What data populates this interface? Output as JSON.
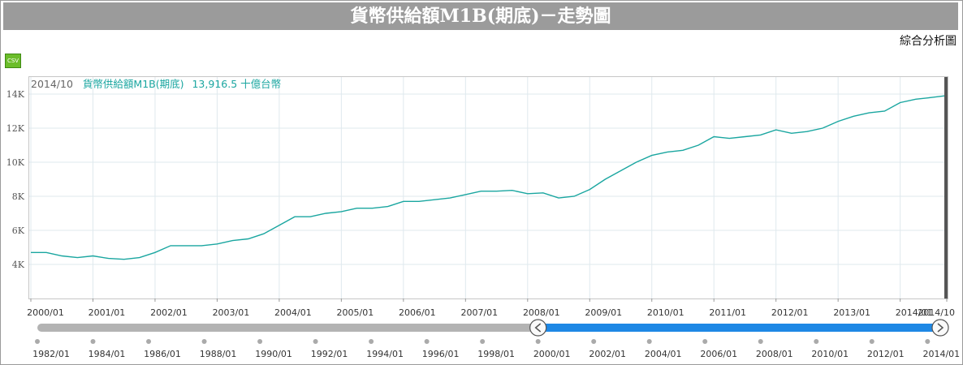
{
  "title": "貨幣供給額M1B(期底)－走勢圖",
  "nav_link": "綜合分析圖",
  "csv_label": "CSV",
  "colors": {
    "line": "#1aa6a0",
    "navigator_fill": "#1e88e5",
    "navigator_track": "#b3b3b3",
    "grid": "#dfe9ee",
    "title_bg": "#9b9b9b"
  },
  "readout": {
    "date": "2014/10",
    "series_name": "貨幣供給額M1B(期底)",
    "value": "13,916.5",
    "unit": "十億台幣"
  },
  "chart_data": {
    "type": "line",
    "title": "貨幣供給額M1B(期底)－走勢圖",
    "xlabel": "",
    "ylabel": "",
    "x_range": [
      "2000/01",
      "2014/10"
    ],
    "ylim": [
      2000,
      15000
    ],
    "y_ticks": [
      4000,
      6000,
      8000,
      10000,
      12000,
      14000
    ],
    "y_tick_labels": [
      "4K",
      "6K",
      "8K",
      "10K",
      "12K",
      "14K"
    ],
    "x_tick_labels": [
      "2000/01",
      "2001/01",
      "2002/01",
      "2003/01",
      "2004/01",
      "2005/01",
      "2006/01",
      "2007/01",
      "2008/01",
      "2009/01",
      "2010/01",
      "2011/01",
      "2012/01",
      "2013/01",
      "2014/01",
      "2014/10"
    ],
    "grid": true,
    "series": [
      {
        "name": "貨幣供給額M1B(期底)",
        "points": [
          [
            "2000/01",
            4700
          ],
          [
            "2000/04",
            4700
          ],
          [
            "2000/07",
            4500
          ],
          [
            "2000/10",
            4400
          ],
          [
            "2001/01",
            4500
          ],
          [
            "2001/04",
            4350
          ],
          [
            "2001/07",
            4300
          ],
          [
            "2001/10",
            4400
          ],
          [
            "2002/01",
            4700
          ],
          [
            "2002/04",
            5100
          ],
          [
            "2002/07",
            5100
          ],
          [
            "2002/10",
            5100
          ],
          [
            "2003/01",
            5200
          ],
          [
            "2003/04",
            5400
          ],
          [
            "2003/07",
            5500
          ],
          [
            "2003/10",
            5800
          ],
          [
            "2004/01",
            6300
          ],
          [
            "2004/04",
            6800
          ],
          [
            "2004/07",
            6800
          ],
          [
            "2004/10",
            7000
          ],
          [
            "2005/01",
            7100
          ],
          [
            "2005/04",
            7300
          ],
          [
            "2005/07",
            7300
          ],
          [
            "2005/10",
            7400
          ],
          [
            "2006/01",
            7700
          ],
          [
            "2006/04",
            7700
          ],
          [
            "2006/07",
            7800
          ],
          [
            "2006/10",
            7900
          ],
          [
            "2007/01",
            8100
          ],
          [
            "2007/04",
            8300
          ],
          [
            "2007/07",
            8300
          ],
          [
            "2007/10",
            8350
          ],
          [
            "2008/01",
            8150
          ],
          [
            "2008/04",
            8200
          ],
          [
            "2008/07",
            7900
          ],
          [
            "2008/10",
            8000
          ],
          [
            "2009/01",
            8400
          ],
          [
            "2009/04",
            9000
          ],
          [
            "2009/07",
            9500
          ],
          [
            "2009/10",
            10000
          ],
          [
            "2010/01",
            10400
          ],
          [
            "2010/04",
            10600
          ],
          [
            "2010/07",
            10700
          ],
          [
            "2010/10",
            11000
          ],
          [
            "2011/01",
            11500
          ],
          [
            "2011/04",
            11400
          ],
          [
            "2011/07",
            11500
          ],
          [
            "2011/10",
            11600
          ],
          [
            "2012/01",
            11900
          ],
          [
            "2012/04",
            11700
          ],
          [
            "2012/07",
            11800
          ],
          [
            "2012/10",
            12000
          ],
          [
            "2013/01",
            12400
          ],
          [
            "2013/04",
            12700
          ],
          [
            "2013/07",
            12900
          ],
          [
            "2013/10",
            13000
          ],
          [
            "2014/01",
            13500
          ],
          [
            "2014/04",
            13700
          ],
          [
            "2014/07",
            13800
          ],
          [
            "2014/10",
            13916.5
          ]
        ]
      }
    ],
    "navigator": {
      "range": [
        "1982/01",
        "2014/10"
      ],
      "selected": [
        "2000/01",
        "2014/10"
      ],
      "tick_labels": [
        "1982/01",
        "1984/01",
        "1986/01",
        "1988/01",
        "1990/01",
        "1992/01",
        "1994/01",
        "1996/01",
        "1998/01",
        "2000/01",
        "2002/01",
        "2004/01",
        "2006/01",
        "2008/01",
        "2010/01",
        "2012/01",
        "2014/01"
      ]
    }
  }
}
